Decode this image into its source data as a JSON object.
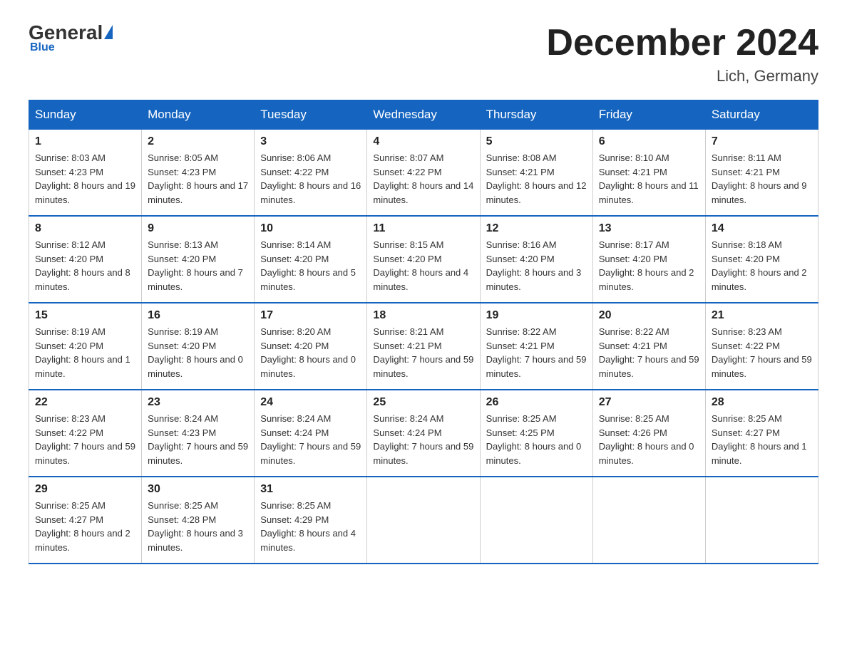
{
  "header": {
    "logo": {
      "general": "General",
      "blue": "Blue",
      "underline": "Blue"
    },
    "title": "December 2024",
    "location": "Lich, Germany"
  },
  "weekdays": [
    "Sunday",
    "Monday",
    "Tuesday",
    "Wednesday",
    "Thursday",
    "Friday",
    "Saturday"
  ],
  "weeks": [
    [
      {
        "day": "1",
        "sunrise": "8:03 AM",
        "sunset": "4:23 PM",
        "daylight": "8 hours and 19 minutes."
      },
      {
        "day": "2",
        "sunrise": "8:05 AM",
        "sunset": "4:23 PM",
        "daylight": "8 hours and 17 minutes."
      },
      {
        "day": "3",
        "sunrise": "8:06 AM",
        "sunset": "4:22 PM",
        "daylight": "8 hours and 16 minutes."
      },
      {
        "day": "4",
        "sunrise": "8:07 AM",
        "sunset": "4:22 PM",
        "daylight": "8 hours and 14 minutes."
      },
      {
        "day": "5",
        "sunrise": "8:08 AM",
        "sunset": "4:21 PM",
        "daylight": "8 hours and 12 minutes."
      },
      {
        "day": "6",
        "sunrise": "8:10 AM",
        "sunset": "4:21 PM",
        "daylight": "8 hours and 11 minutes."
      },
      {
        "day": "7",
        "sunrise": "8:11 AM",
        "sunset": "4:21 PM",
        "daylight": "8 hours and 9 minutes."
      }
    ],
    [
      {
        "day": "8",
        "sunrise": "8:12 AM",
        "sunset": "4:20 PM",
        "daylight": "8 hours and 8 minutes."
      },
      {
        "day": "9",
        "sunrise": "8:13 AM",
        "sunset": "4:20 PM",
        "daylight": "8 hours and 7 minutes."
      },
      {
        "day": "10",
        "sunrise": "8:14 AM",
        "sunset": "4:20 PM",
        "daylight": "8 hours and 5 minutes."
      },
      {
        "day": "11",
        "sunrise": "8:15 AM",
        "sunset": "4:20 PM",
        "daylight": "8 hours and 4 minutes."
      },
      {
        "day": "12",
        "sunrise": "8:16 AM",
        "sunset": "4:20 PM",
        "daylight": "8 hours and 3 minutes."
      },
      {
        "day": "13",
        "sunrise": "8:17 AM",
        "sunset": "4:20 PM",
        "daylight": "8 hours and 2 minutes."
      },
      {
        "day": "14",
        "sunrise": "8:18 AM",
        "sunset": "4:20 PM",
        "daylight": "8 hours and 2 minutes."
      }
    ],
    [
      {
        "day": "15",
        "sunrise": "8:19 AM",
        "sunset": "4:20 PM",
        "daylight": "8 hours and 1 minute."
      },
      {
        "day": "16",
        "sunrise": "8:19 AM",
        "sunset": "4:20 PM",
        "daylight": "8 hours and 0 minutes."
      },
      {
        "day": "17",
        "sunrise": "8:20 AM",
        "sunset": "4:20 PM",
        "daylight": "8 hours and 0 minutes."
      },
      {
        "day": "18",
        "sunrise": "8:21 AM",
        "sunset": "4:21 PM",
        "daylight": "7 hours and 59 minutes."
      },
      {
        "day": "19",
        "sunrise": "8:22 AM",
        "sunset": "4:21 PM",
        "daylight": "7 hours and 59 minutes."
      },
      {
        "day": "20",
        "sunrise": "8:22 AM",
        "sunset": "4:21 PM",
        "daylight": "7 hours and 59 minutes."
      },
      {
        "day": "21",
        "sunrise": "8:23 AM",
        "sunset": "4:22 PM",
        "daylight": "7 hours and 59 minutes."
      }
    ],
    [
      {
        "day": "22",
        "sunrise": "8:23 AM",
        "sunset": "4:22 PM",
        "daylight": "7 hours and 59 minutes."
      },
      {
        "day": "23",
        "sunrise": "8:24 AM",
        "sunset": "4:23 PM",
        "daylight": "7 hours and 59 minutes."
      },
      {
        "day": "24",
        "sunrise": "8:24 AM",
        "sunset": "4:24 PM",
        "daylight": "7 hours and 59 minutes."
      },
      {
        "day": "25",
        "sunrise": "8:24 AM",
        "sunset": "4:24 PM",
        "daylight": "7 hours and 59 minutes."
      },
      {
        "day": "26",
        "sunrise": "8:25 AM",
        "sunset": "4:25 PM",
        "daylight": "8 hours and 0 minutes."
      },
      {
        "day": "27",
        "sunrise": "8:25 AM",
        "sunset": "4:26 PM",
        "daylight": "8 hours and 0 minutes."
      },
      {
        "day": "28",
        "sunrise": "8:25 AM",
        "sunset": "4:27 PM",
        "daylight": "8 hours and 1 minute."
      }
    ],
    [
      {
        "day": "29",
        "sunrise": "8:25 AM",
        "sunset": "4:27 PM",
        "daylight": "8 hours and 2 minutes."
      },
      {
        "day": "30",
        "sunrise": "8:25 AM",
        "sunset": "4:28 PM",
        "daylight": "8 hours and 3 minutes."
      },
      {
        "day": "31",
        "sunrise": "8:25 AM",
        "sunset": "4:29 PM",
        "daylight": "8 hours and 4 minutes."
      },
      null,
      null,
      null,
      null
    ]
  ]
}
